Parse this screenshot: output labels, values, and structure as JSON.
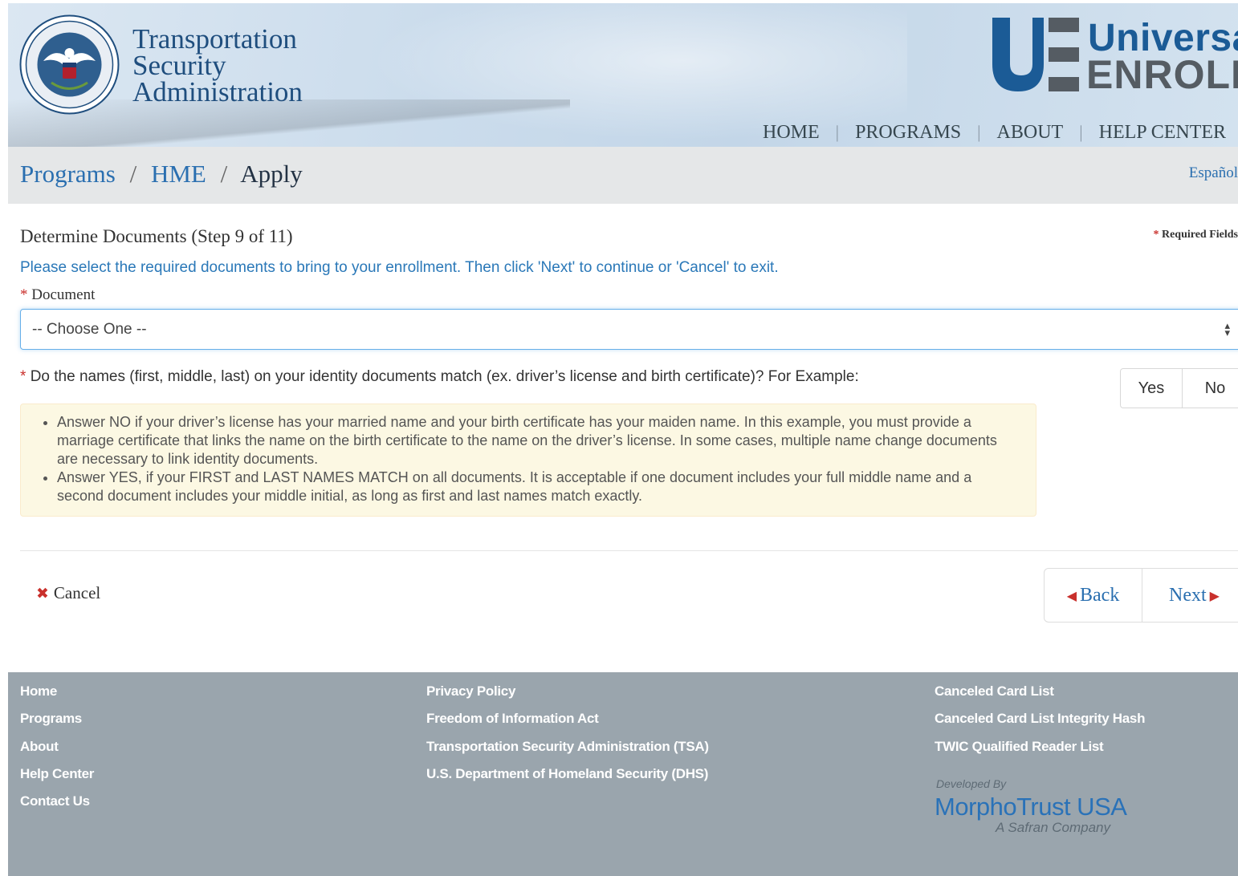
{
  "header": {
    "agency_lines": [
      "Transportation",
      "Security",
      "Administration"
    ],
    "brand_line1": "Universal",
    "brand_line2": "ENROLL",
    "nav": [
      "HOME",
      "PROGRAMS",
      "ABOUT",
      "HELP CENTER"
    ]
  },
  "breadcrumb": {
    "items": [
      "Programs",
      "HME",
      "Apply"
    ],
    "separator": "/",
    "language_link": "Español"
  },
  "form": {
    "step_title": "Determine Documents (Step 9 of 11)",
    "required_note": "Required Fields",
    "required_marker": "*",
    "instruction": "Please select the required documents to bring to your enrollment. Then click 'Next' to continue or 'Cancel' to exit.",
    "document_label": "Document",
    "document_select_value": "-- Choose One --",
    "question": "Do the names (first, middle, last) on your identity documents match (ex. driver’s license and birth certificate)? For Example:",
    "yes_label": "Yes",
    "no_label": "No",
    "hints": [
      "Answer NO if your driver’s license has your married name and your birth certificate has your maiden name. In this example, you must provide a marriage certificate that links the name on the birth certificate to the name on the driver’s license. In some cases, multiple name change documents are necessary to link identity documents.",
      "Answer YES, if your FIRST and LAST NAMES MATCH on all documents. It is acceptable if one document includes your full middle name and a second document includes your middle initial, as long as first and last names match exactly."
    ],
    "cancel_label": "Cancel",
    "back_label": "Back",
    "next_label": "Next"
  },
  "footer": {
    "col1": [
      "Home",
      "Programs",
      "About",
      "Help Center",
      "Contact Us"
    ],
    "col2": [
      "Privacy Policy",
      "Freedom of Information Act",
      "Transportation Security Administration (TSA)",
      "U.S. Department of Homeland Security (DHS)"
    ],
    "col3": [
      "Canceled Card List",
      "Canceled Card List Integrity Hash",
      "TWIC Qualified Reader List"
    ],
    "developed_by": "Developed By",
    "developer": "MorphoTrust USA",
    "developer_tagline": "A Safran Company"
  },
  "colors": {
    "link_blue": "#2a6fb0",
    "required_red": "#c9302c",
    "alert_bg": "#fcf8e3",
    "footer_bg": "#9aa5ad",
    "brand_blue": "#1b5b96"
  },
  "icons": {
    "seal": "dhs-seal-icon",
    "cancel": "x-icon",
    "back": "caret-left-icon",
    "next": "caret-right-icon",
    "select": "select-arrows-icon"
  }
}
